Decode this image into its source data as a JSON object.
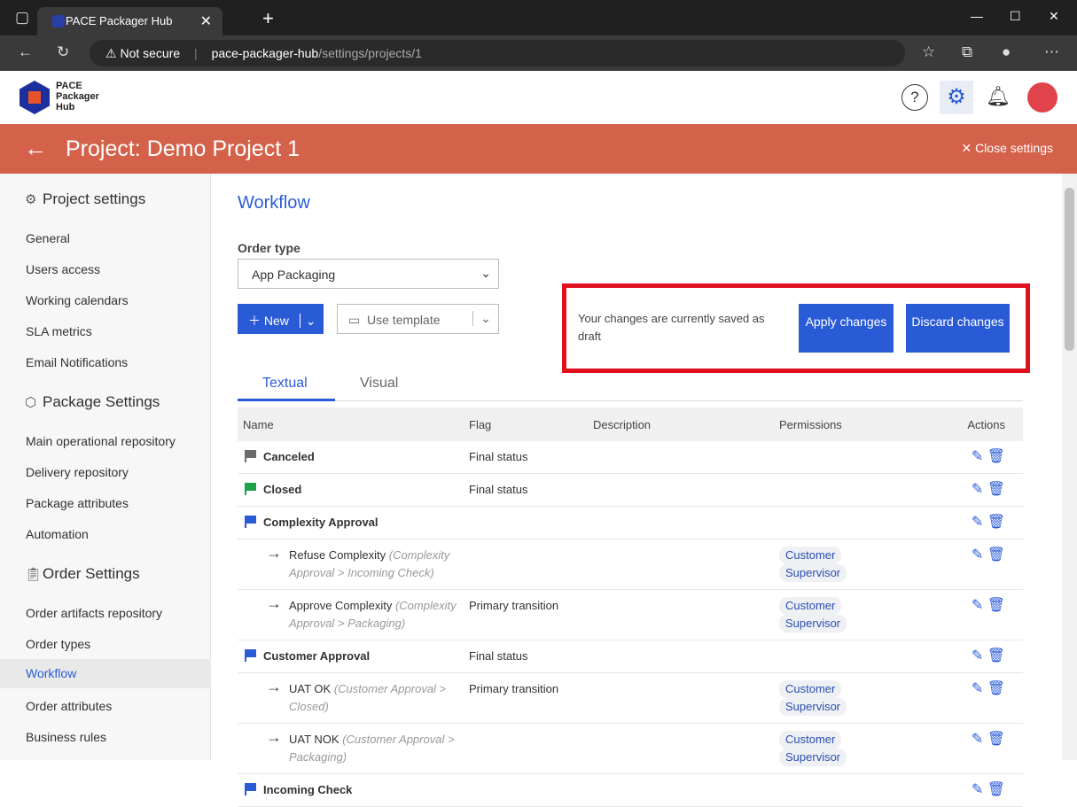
{
  "browser": {
    "tab_title": "PACE Packager Hub",
    "security": "Not secure",
    "url_host": "pace-packager-hub",
    "url_path": "/settings/projects/1"
  },
  "app": {
    "logo_text": "PACE Packager Hub",
    "logo_lines": [
      "PACE",
      "Packager",
      "Hub"
    ]
  },
  "header": {
    "title": "Project: Demo Project 1",
    "close_label": "Close settings"
  },
  "sidebar": {
    "sections": [
      {
        "title": "Project settings",
        "icon": "gear-icon",
        "items": [
          "General",
          "Users access",
          "Working calendars",
          "SLA metrics",
          "Email Notifications"
        ]
      },
      {
        "title": "Package Settings",
        "icon": "package-icon",
        "items": [
          "Main operational repository",
          "Delivery repository",
          "Package attributes",
          "Automation"
        ]
      },
      {
        "title": "Order Settings",
        "icon": "clipboard-icon",
        "items": [
          "Order artifacts repository",
          "Order types",
          "Workflow",
          "Order attributes",
          "Business rules"
        ]
      }
    ],
    "active": "Workflow"
  },
  "main": {
    "title": "Workflow",
    "order_type_label": "Order type",
    "order_type_value": "App Packaging",
    "new_label": "New",
    "template_label": "Use template",
    "draft_message": "Your changes are currently saved as draft",
    "apply_label": "Apply changes",
    "discard_label": "Discard changes",
    "tabs": [
      "Textual",
      "Visual"
    ],
    "active_tab": "Textual",
    "columns": [
      "Name",
      "Flag",
      "Description",
      "Permissions",
      "Actions"
    ],
    "rows": [
      {
        "type": "status",
        "name": "Canceled",
        "flag_color": "#6b6b6b",
        "flag": "Final status",
        "permissions": []
      },
      {
        "type": "status",
        "name": "Closed",
        "flag_color": "#1fa34a",
        "flag": "Final status",
        "permissions": []
      },
      {
        "type": "status",
        "name": "Complexity Approval",
        "flag_color": "#2a5bd7",
        "flag": "",
        "permissions": []
      },
      {
        "type": "transition",
        "name": "Refuse Complexity",
        "path": "(Complexity Approval > Incoming Check)",
        "flag": "",
        "permissions": [
          "Customer",
          "Supervisor"
        ]
      },
      {
        "type": "transition",
        "name": "Approve Complexity",
        "path": "(Complexity Approval > Packaging)",
        "flag": "Primary transition",
        "permissions": [
          "Customer",
          "Supervisor"
        ]
      },
      {
        "type": "status",
        "name": "Customer Approval",
        "flag_color": "#2a5bd7",
        "flag": "Final status",
        "permissions": []
      },
      {
        "type": "transition",
        "name": "UAT OK",
        "path": "(Customer Approval > Closed)",
        "flag": "Primary transition",
        "permissions": [
          "Customer",
          "Supervisor"
        ]
      },
      {
        "type": "transition",
        "name": "UAT NOK",
        "path": "(Customer Approval > Packaging)",
        "flag": "",
        "permissions": [
          "Customer",
          "Supervisor"
        ]
      },
      {
        "type": "status",
        "name": "Incoming Check",
        "flag_color": "#2a5bd7",
        "flag": "",
        "permissions": []
      }
    ]
  },
  "colors": {
    "accent": "#2a5bd7",
    "header_bar": "#d4614a",
    "highlight_box": "#e0101e"
  }
}
